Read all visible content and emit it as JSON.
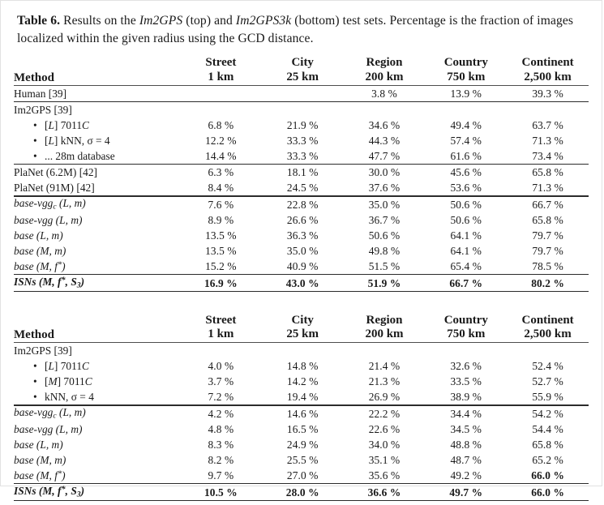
{
  "caption": {
    "label": "Table 6.",
    "part1": " Results on the ",
    "dataset_top": "Im2GPS",
    "part2": " (top) and ",
    "dataset_bottom": "Im2GPS3k",
    "part3": " (bottom) test sets. Percentage is the fraction of images localized within the given radius using the GCD distance."
  },
  "columns": [
    {
      "name": "Method",
      "unit": ""
    },
    {
      "name": "Street",
      "unit": "1 km"
    },
    {
      "name": "City",
      "unit": "25 km"
    },
    {
      "name": "Region",
      "unit": "200 km"
    },
    {
      "name": "Country",
      "unit": "750 km"
    },
    {
      "name": "Continent",
      "unit": "2,500 km"
    }
  ],
  "table_top": {
    "groups": [
      {
        "rows": [
          {
            "method": "Human [39]",
            "values": [
              "",
              "",
              "3.8 %",
              "13.9 %",
              "39.3 %"
            ]
          }
        ]
      },
      {
        "rows": [
          {
            "method": "Im2GPS [39]",
            "values": [
              "",
              "",
              "",
              "",
              ""
            ]
          },
          {
            "bullet": true,
            "method": "[L] 7011C",
            "values": [
              "6.8 %",
              "21.9 %",
              "34.6 %",
              "49.4 %",
              "63.7 %"
            ]
          },
          {
            "bullet": true,
            "method": "[L] kNN, σ = 4",
            "values": [
              "12.2 %",
              "33.3 %",
              "44.3 %",
              "57.4 %",
              "71.3 %"
            ]
          },
          {
            "bullet": true,
            "method": "... 28m database",
            "values": [
              "14.4 %",
              "33.3 %",
              "47.7 %",
              "61.6 %",
              "73.4 %"
            ]
          }
        ]
      },
      {
        "rows": [
          {
            "method": "PlaNet (6.2M) [42]",
            "values": [
              "6.3 %",
              "18.1 %",
              "30.0 %",
              "45.6 %",
              "65.8 %"
            ]
          },
          {
            "method": "PlaNet (91M) [42]",
            "values": [
              "8.4 %",
              "24.5 %",
              "37.6 %",
              "53.6 %",
              "71.3 %"
            ]
          }
        ]
      },
      {
        "rows": [
          {
            "method": "base-vggc (L, m)",
            "values": [
              "7.6 %",
              "22.8 %",
              "35.0 %",
              "50.6 %",
              "66.7 %"
            ]
          },
          {
            "method": "base-vgg (L, m)",
            "values": [
              "8.9 %",
              "26.6 %",
              "36.7 %",
              "50.6 %",
              "65.8 %"
            ]
          },
          {
            "method": "base (L, m)",
            "values": [
              "13.5 %",
              "36.3 %",
              "50.6 %",
              "64.1 %",
              "79.7 %"
            ]
          },
          {
            "method": "base (M, m)",
            "values": [
              "13.5 %",
              "35.0 %",
              "49.8 %",
              "64.1 %",
              "79.7 %"
            ]
          },
          {
            "method": "base (M, f*)",
            "values": [
              "15.2 %",
              "40.9 %",
              "51.5 %",
              "65.4 %",
              "78.5 %"
            ]
          }
        ]
      },
      {
        "rows": [
          {
            "method": "ISNs (M, f*, S3)",
            "values": [
              "16.9 %",
              "43.0 %",
              "51.9 %",
              "66.7 %",
              "80.2 %"
            ]
          }
        ]
      }
    ]
  },
  "table_bottom": {
    "groups": [
      {
        "rows": [
          {
            "method": "Im2GPS [39]",
            "values": [
              "",
              "",
              "",
              "",
              ""
            ]
          },
          {
            "bullet": true,
            "method": "[L] 7011C",
            "values": [
              "4.0 %",
              "14.8 %",
              "21.4 %",
              "32.6 %",
              "52.4 %"
            ]
          },
          {
            "bullet": true,
            "method": "[M] 7011C",
            "values": [
              "3.7 %",
              "14.2 %",
              "21.3 %",
              "33.5 %",
              "52.7 %"
            ]
          },
          {
            "bullet": true,
            "method": "kNN, σ = 4",
            "values": [
              "7.2 %",
              "19.4 %",
              "26.9 %",
              "38.9 %",
              "55.9 %"
            ]
          }
        ]
      },
      {
        "rows": [
          {
            "method": "base-vggc (L, m)",
            "values": [
              "4.2 %",
              "14.6 %",
              "22.2 %",
              "34.4 %",
              "54.2 %"
            ]
          },
          {
            "method": "base-vgg (L, m)",
            "values": [
              "4.8 %",
              "16.5 %",
              "22.6 %",
              "34.5 %",
              "54.4 %"
            ]
          },
          {
            "method": "base (L, m)",
            "values": [
              "8.3 %",
              "24.9 %",
              "34.0 %",
              "48.8 %",
              "65.8 %"
            ]
          },
          {
            "method": "base (M, m)",
            "values": [
              "8.2 %",
              "25.5 %",
              "35.1 %",
              "48.7 %",
              "65.2 %"
            ]
          },
          {
            "method": "base (M, f*)",
            "values": [
              "9.7 %",
              "27.0 %",
              "35.6 %",
              "49.2 %",
              "66.0 %"
            ]
          }
        ]
      },
      {
        "rows": [
          {
            "method": "ISNs (M, f*, S3)",
            "values": [
              "10.5 %",
              "28.0 %",
              "36.6 %",
              "49.7 %",
              "66.0 %"
            ]
          }
        ]
      }
    ]
  }
}
